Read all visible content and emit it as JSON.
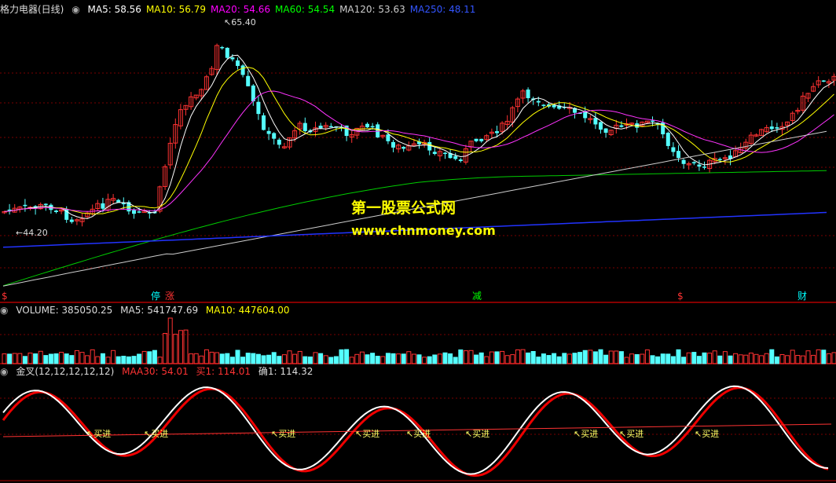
{
  "stock": {
    "title": "格力电器(日线)"
  },
  "ma_header": {
    "items": [
      {
        "label": "MA5: 58.56",
        "color": "#ffffff"
      },
      {
        "label": "MA10: 56.79",
        "color": "#ffff00"
      },
      {
        "label": "MA20: 54.66",
        "color": "#ff00ff"
      },
      {
        "label": "MA60: 54.54",
        "color": "#00ff00"
      },
      {
        "label": "MA120: 53.63",
        "color": "#cccccc"
      },
      {
        "label": "MA250: 48.11",
        "color": "#3355ff"
      }
    ]
  },
  "price_labels": {
    "high": "65.40",
    "low": "44.20"
  },
  "watermark": {
    "line1": "第一股票公式网",
    "line2": "www.chnmoney.com"
  },
  "event_markers": [
    {
      "text": "$",
      "color": "#ff3333"
    },
    {
      "text": "停",
      "color": "#00ffff"
    },
    {
      "text": "涨",
      "color": "#ff3333"
    },
    {
      "text": "减",
      "color": "#00ff00"
    },
    {
      "text": "$",
      "color": "#ff3333"
    },
    {
      "text": "财",
      "color": "#00ffff"
    }
  ],
  "volume_header": {
    "title": "VOLUME: 385050.25",
    "ma5": "MA5: 541747.69",
    "ma10": "MA10: 447604.00"
  },
  "indicator_header": {
    "title": "金叉(12,12,12,12,12)",
    "maa30": "MAA30: 54.01",
    "buy1": "买1: 114.01",
    "confirm1": "确1: 114.32"
  },
  "buy_signal_label": "买进",
  "colors": {
    "up": "#ff3232",
    "down": "#54ffff",
    "grid": "#7a0000",
    "divider": "#b00000"
  }
}
